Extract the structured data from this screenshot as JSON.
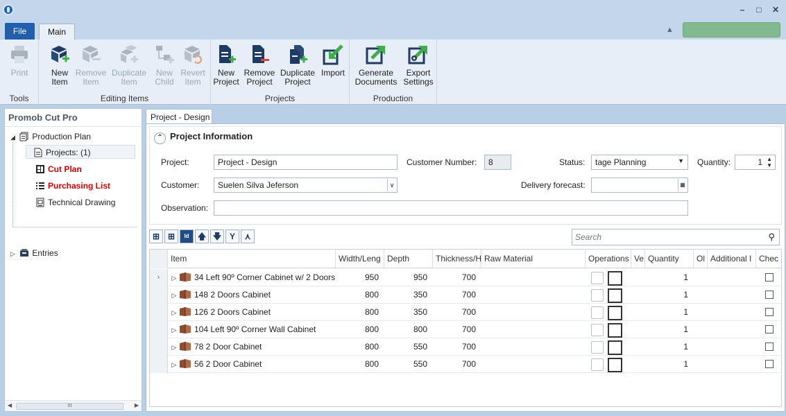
{
  "colors": {
    "accent": "#1f5fae",
    "ribbon_bg": "#e7eef7",
    "title_bg": "#c3d6ea",
    "green_box": "#82b98f",
    "red_label": "#d50000",
    "cabinet_brown": "#8b4c32",
    "ribbon_icon_blue": "#1f3b63",
    "ribbon_icon_green": "#3fae49"
  },
  "window": {
    "icon": "promob-logo-icon",
    "controls": [
      "minimize-icon",
      "maximize-icon",
      "close-icon"
    ]
  },
  "tabs": {
    "file": "File",
    "main": "Main"
  },
  "ribbon": {
    "groups": [
      {
        "label": "Tools",
        "buttons": [
          {
            "line1": "Print",
            "line2": "",
            "icon": "printer-icon",
            "enabled": false
          }
        ]
      },
      {
        "label": "Editing Items",
        "buttons": [
          {
            "line1": "New",
            "line2": "Item",
            "icon": "new-item-icon",
            "enabled": true
          },
          {
            "line1": "Remove",
            "line2": "Item",
            "icon": "remove-item-icon",
            "enabled": false
          },
          {
            "line1": "Duplicate",
            "line2": "Item",
            "icon": "duplicate-item-icon",
            "enabled": false
          },
          {
            "line1": "New",
            "line2": "Child",
            "icon": "new-child-icon",
            "enabled": false
          },
          {
            "line1": "Revert",
            "line2": "Item",
            "icon": "revert-item-icon",
            "enabled": false
          }
        ]
      },
      {
        "label": "Projects",
        "buttons": [
          {
            "line1": "New",
            "line2": "Project",
            "icon": "new-project-icon",
            "enabled": true
          },
          {
            "line1": "Remove",
            "line2": "Project",
            "icon": "remove-project-icon",
            "enabled": true
          },
          {
            "line1": "Duplicate",
            "line2": "Project",
            "icon": "duplicate-project-icon",
            "enabled": true
          },
          {
            "line1": "Import",
            "line2": "",
            "icon": "import-icon",
            "enabled": true
          }
        ]
      },
      {
        "label": "Production",
        "buttons": [
          {
            "line1": "Generate",
            "line2": "Documents",
            "icon": "generate-documents-icon",
            "enabled": true
          },
          {
            "line1": "Export",
            "line2": "Settings",
            "icon": "export-settings-icon",
            "enabled": true
          }
        ]
      }
    ]
  },
  "left_panel": {
    "title": "Promob Cut Pro",
    "tree": {
      "production_plan": "Production Plan",
      "projects": "Projects: (1)",
      "cut_plan": "Cut Plan",
      "purchasing_list": "Purchasing List",
      "technical_drawing": "Technical Drawing",
      "entries": "Entries"
    },
    "scrollbar_grip": "III"
  },
  "doc_tab": "Project - Design",
  "project_info": {
    "header": "Project Information",
    "project_label": "Project:",
    "project_value": "Project - Design",
    "customer_number_label": "Customer Number:",
    "customer_number_value": "8",
    "status_label": "Status:",
    "status_value": "tage Planning",
    "quantity_label": "Quantity:",
    "quantity_value": "1",
    "customer_label": "Customer:",
    "customer_value": "Suelen Silva Jeferson",
    "delivery_label": "Delivery forecast:",
    "delivery_value": "",
    "observation_label": "Observation:",
    "observation_value": ""
  },
  "grid_toolbar": {
    "buttons": [
      "expand-all-icon",
      "add-icon",
      "id-icon",
      "arrow-up-icon",
      "arrow-down-icon",
      "merge-icon",
      "split-icon"
    ],
    "id_label": "Id",
    "search_placeholder": "Search"
  },
  "grid": {
    "columns": [
      "Item",
      "Width/Leng",
      "Depth",
      "Thickness/H",
      "Raw Material",
      "Operations",
      "Ve",
      "Quantity",
      "Ol",
      "Additional I",
      "Chec"
    ],
    "rows": [
      {
        "item": "34  Left 90º Corner Cabinet w/ 2 Doors",
        "width": "950",
        "depth": "950",
        "thickness": "700",
        "raw_material": "",
        "quantity": "1",
        "current": true
      },
      {
        "item": "148  2 Doors Cabinet",
        "width": "800",
        "depth": "350",
        "thickness": "700",
        "raw_material": "",
        "quantity": "1",
        "current": false
      },
      {
        "item": "126  2 Doors Cabinet",
        "width": "800",
        "depth": "350",
        "thickness": "700",
        "raw_material": "",
        "quantity": "1",
        "current": false
      },
      {
        "item": "104  Left 90º Corner Wall Cabinet",
        "width": "800",
        "depth": "800",
        "thickness": "700",
        "raw_material": "",
        "quantity": "1",
        "current": false
      },
      {
        "item": "78  2 Door Cabinet",
        "width": "800",
        "depth": "550",
        "thickness": "700",
        "raw_material": "",
        "quantity": "1",
        "current": false
      },
      {
        "item": "56  2 Door Cabinet",
        "width": "800",
        "depth": "550",
        "thickness": "700",
        "raw_material": "",
        "quantity": "1",
        "current": false
      }
    ]
  }
}
